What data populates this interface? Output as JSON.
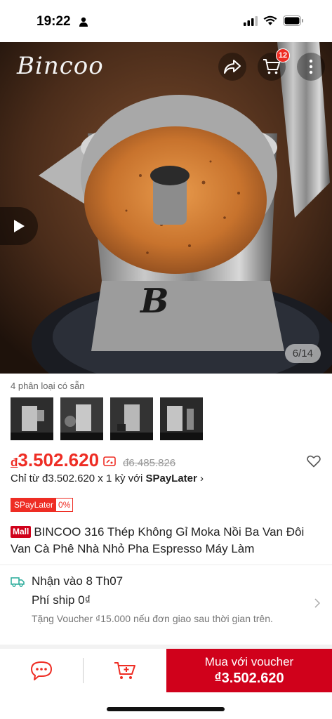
{
  "status_bar": {
    "time": "19:22"
  },
  "hero": {
    "brand_logo": "Bincoo",
    "cart_count": "12",
    "page_counter": "6/14"
  },
  "variants": {
    "label": "4 phân loại có sẵn",
    "count": 4
  },
  "price": {
    "currency": "đ",
    "current": "3.502.620",
    "original": "đ6.485.826"
  },
  "spaylater": {
    "prefix": "Chỉ từ đ3.502.620 x 1 kỳ với",
    "brand": "SPayLater",
    "tag_name": "SPayLater",
    "tag_rate": "0%"
  },
  "product": {
    "mall_badge": "Mall",
    "title": "BINCOO 316 Thép Không Gỉ Moka Nồi Ba Van Đôi Van Cà Phê Nhà Nhỏ Pha Espresso Máy Làm"
  },
  "shipping": {
    "date": "Nhận vào 8 Th07",
    "fee": "Phí ship 0₫",
    "voucher": "Tặng Voucher ₫15.000 nếu đơn giao sau thời gian trên."
  },
  "bottom_bar": {
    "buy_label": "Mua với voucher",
    "buy_price": "₫3.502.620"
  },
  "colors": {
    "accent": "#ee2d24",
    "buy_button": "#d0011b",
    "shipping_icon": "#26aa99"
  }
}
